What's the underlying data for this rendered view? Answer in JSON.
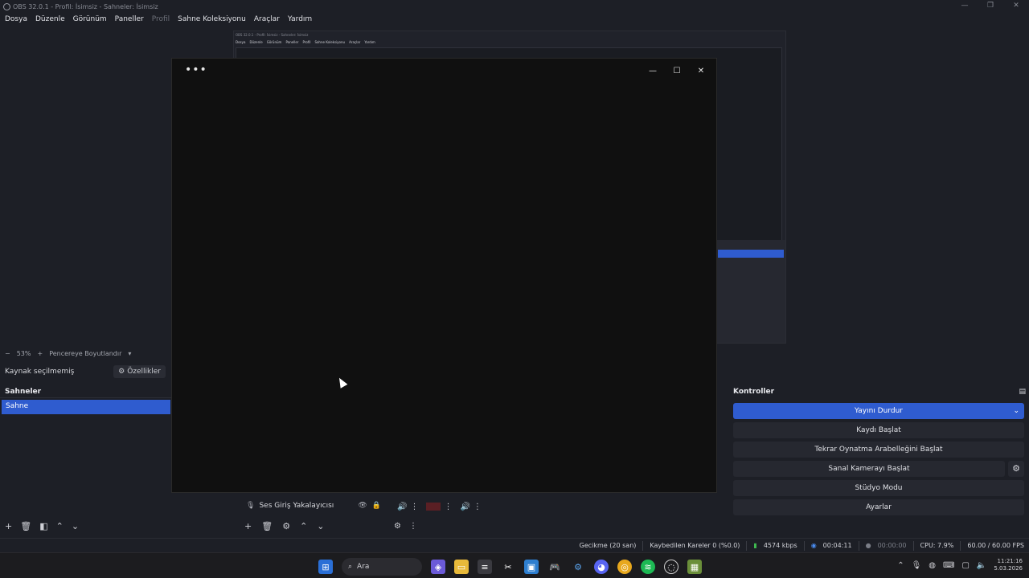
{
  "window": {
    "title": "OBS 32.0.1 - Profil: İsimsiz - Sahneler: İsimsiz",
    "minimize": "—",
    "restore": "❐",
    "close": "✕"
  },
  "menu": [
    "Dosya",
    "Düzenle",
    "Görünüm",
    "Paneller",
    "Profil",
    "Sahne Koleksiyonu",
    "Araçlar",
    "Yardım"
  ],
  "zoom": {
    "minus": "−",
    "value": "53%",
    "plus": "+",
    "fit_label": "Pencereye Boyutlandır"
  },
  "source_bar": {
    "no_source": "Kaynak seçilmemiş",
    "properties": "Özellikler"
  },
  "scenes": {
    "header": "Sahneler",
    "items": [
      "Sahne"
    ]
  },
  "sources": {
    "item": "Ses Giriş Yakalayıcısı"
  },
  "controls": {
    "header": "Kontroller",
    "stop_stream": "Yayını Durdur",
    "start_recording": "Kaydı Başlat",
    "start_replay": "Tekrar Oynatma Arabelleğini Başlat",
    "start_vcam": "Sanal Kamerayı Başlat",
    "studio_mode": "Stüdyo Modu",
    "settings": "Ayarlar"
  },
  "status": {
    "delay": "Gecikme (20 san)",
    "dropped": "Kaybedilen Kareler 0 (%0.0)",
    "bitrate": "4574 kbps",
    "stream_time": "00:04:11",
    "rec_time": "00:00:00",
    "cpu": "CPU: 7.9%",
    "fps": "60.00 / 60.00 FPS"
  },
  "taskbar": {
    "search_placeholder": "Ara",
    "time": "11:21:16",
    "date": "5.03.2026"
  },
  "overlay": {
    "more": "•••",
    "minimize": "—",
    "maximize": "☐",
    "close": "✕"
  },
  "colors": {
    "accent": "#2f5ccf",
    "background": "#1d1f26",
    "overlay": "#101010"
  }
}
